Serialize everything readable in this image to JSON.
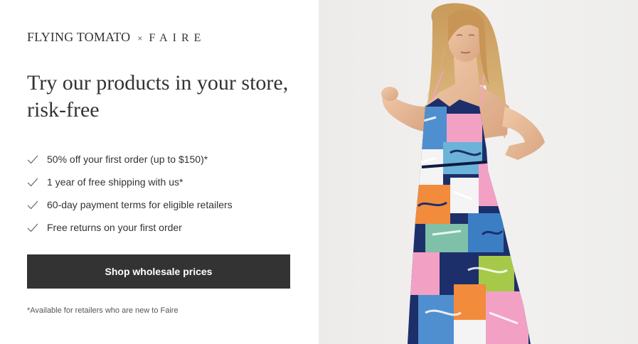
{
  "brand": {
    "store_name": "FLYING TOMATO",
    "separator": "×",
    "partner_name": "FAIRE"
  },
  "headline": "Try our products in your store, risk-free",
  "benefits": [
    {
      "icon": "check-icon",
      "text": "50% off your first order (up to $150)*"
    },
    {
      "icon": "check-icon",
      "text": "1 year of free shipping with us*"
    },
    {
      "icon": "check-icon",
      "text": "60-day payment terms for eligible retailers"
    },
    {
      "icon": "check-icon",
      "text": "Free returns on your first order"
    }
  ],
  "cta": {
    "label": "Shop wholesale prices"
  },
  "disclaimer": "*Available for retailers who are new to Faire",
  "colors": {
    "text": "#333333",
    "button_bg": "#333333",
    "button_text": "#ffffff",
    "image_bg": "#eeedec"
  }
}
